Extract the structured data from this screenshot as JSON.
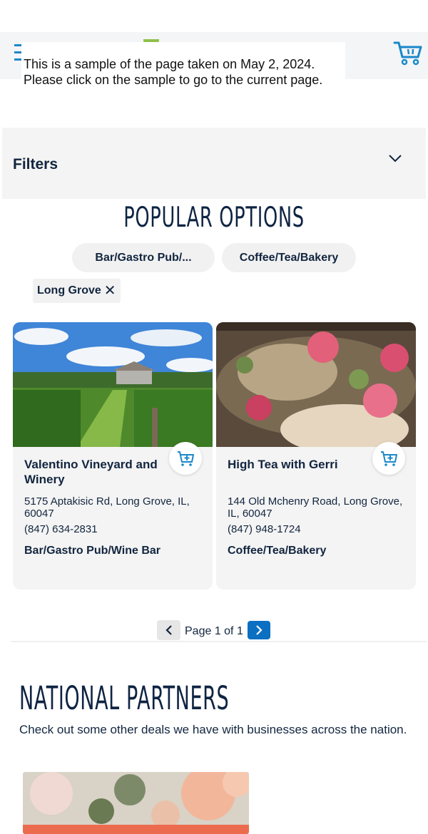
{
  "banner": {
    "line1": "This is a sample of the page taken on May 2, 2024.",
    "line2": "Please click on the sample to go to the current page."
  },
  "filters": {
    "title": "Filters"
  },
  "popular": {
    "title": "POPULAR OPTIONS",
    "chips": [
      "Bar/Gastro Pub/...",
      "Coffee/Tea/Bakery"
    ],
    "active_tag": "Long Grove",
    "active_tag_close": "✕"
  },
  "listings": [
    {
      "name": "Valentino Vineyard and Winery",
      "address": "5175 Aptakisic Rd, Long Grove, IL, 60047",
      "phone": "(847) 634-2831",
      "category": "Bar/Gastro Pub/Wine Bar"
    },
    {
      "name": "High Tea with Gerri",
      "address": "144 Old Mchenry Road, Long Grove, IL, 60047",
      "phone": "(847) 948-1724",
      "category": "Coffee/Tea/Bakery"
    }
  ],
  "pagination": {
    "text": "Page 1 of 1"
  },
  "national": {
    "title": "NATIONAL PARTNERS",
    "description": "Check out some other deals we have with businesses across the nation."
  },
  "colors": {
    "accent": "#1a88c9",
    "navy": "#12253f",
    "next_button": "#0b6fc2",
    "card_bg": "#f4f4f4"
  }
}
